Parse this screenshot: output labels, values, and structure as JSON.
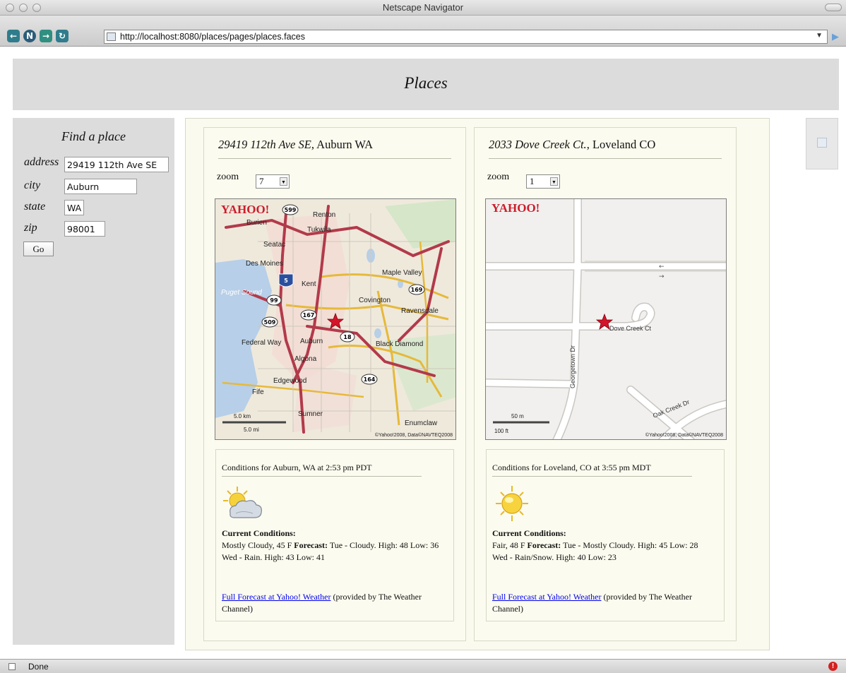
{
  "window": {
    "title": "Netscape Navigator"
  },
  "browser": {
    "url": "http://localhost:8080/places/pages/places.faces"
  },
  "page": {
    "title": "Places"
  },
  "finder": {
    "title": "Find a place",
    "fields": [
      {
        "label": "address",
        "value": "29419 112th Ave SE"
      },
      {
        "label": "city",
        "value": "Auburn"
      },
      {
        "label": "state",
        "value": "WA"
      },
      {
        "label": "zip",
        "value": "98001"
      }
    ],
    "go_label": "Go"
  },
  "places": [
    {
      "street": "29419 112th Ave SE",
      "city_state": ", Auburn WA",
      "zoom_label": "zoom",
      "zoom": "7",
      "map": {
        "logo": "YAHOO!",
        "scale_km": "5.0 km",
        "scale_mi": "5.0 mi",
        "copyright": "©Yahoo!2008, Data©NAVTEQ2008",
        "labels": [
          "Renton",
          "Burien",
          "Tukwila",
          "Seatac",
          "Des Moines",
          "Maple Valley",
          "Kent",
          "Puget Sound",
          "Covington",
          "Ravensdale",
          "Federal Way",
          "Auburn",
          "Black Diamond",
          "Algona",
          "Edgewood",
          "Fife",
          "Sumner",
          "Enumclaw"
        ],
        "shields": [
          "599",
          "5",
          "169",
          "99",
          "167",
          "509",
          "18",
          "164"
        ]
      },
      "conditions_title": "Conditions for Auburn, WA at 2:53 pm PDT",
      "icon": "partly-cloudy-icon",
      "current_label": "Current Conditions:",
      "current": "Mostly Cloudy, 45 F",
      "forecast_label": "Forecast:",
      "forecast_line1": "Tue - Cloudy. High: 48 Low: 36",
      "forecast_line2": "Wed - Rain. High: 43 Low: 41",
      "link_text": "Full Forecast at Yahoo! Weather",
      "link_suffix": " (provided by The Weather Channel)"
    },
    {
      "street": "2033 Dove Creek Ct.",
      "city_state": ", Loveland CO",
      "zoom_label": "zoom",
      "zoom": "1",
      "map": {
        "logo": "YAHOO!",
        "scale_m": "50 m",
        "scale_ft": "100 ft",
        "copyright": "©Yahoo!2008, Data©NAVTEQ2008",
        "labels": [
          "Dove Creek Ct",
          "Georgetown Dr",
          "Oak Creek Dr"
        ]
      },
      "conditions_title": "Conditions for Loveland, CO at 3:55 pm MDT",
      "icon": "sunny-icon",
      "current_label": "Current Conditions:",
      "current": "Fair, 48 F",
      "forecast_label": "Forecast:",
      "forecast_line1": "Tue - Mostly Cloudy. High: 45 Low: 28",
      "forecast_line2": "Wed - Rain/Snow. High: 40 Low: 23",
      "link_text": "Full Forecast at Yahoo! Weather",
      "link_suffix": " (provided by The Weather Channel)"
    }
  ],
  "status": {
    "text": "Done"
  }
}
